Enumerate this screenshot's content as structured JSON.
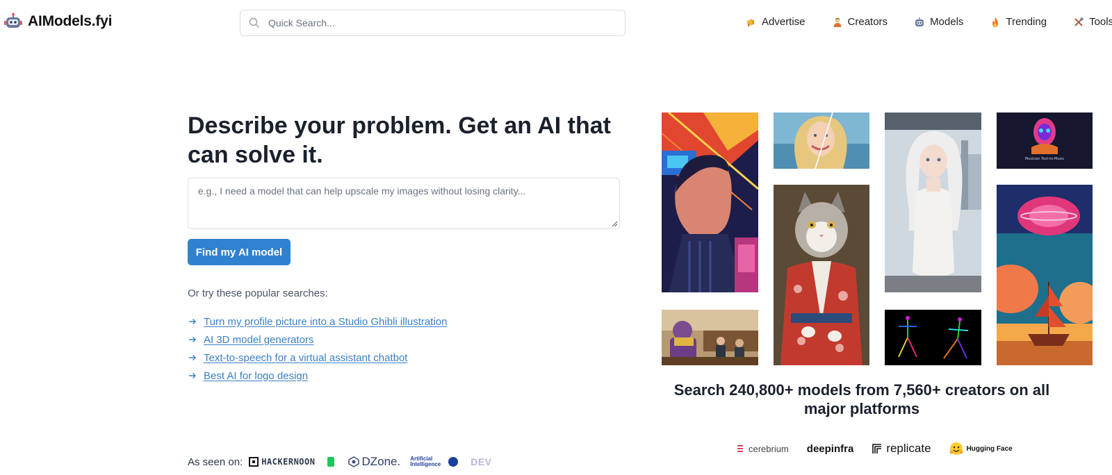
{
  "header": {
    "logo_text": "AIModels.fyi",
    "search_placeholder": "Quick Search...",
    "nav": [
      {
        "label": "Advertise",
        "icon": "megaphone-icon"
      },
      {
        "label": "Creators",
        "icon": "person-icon"
      },
      {
        "label": "Models",
        "icon": "robot-icon"
      },
      {
        "label": "Trending",
        "icon": "fire-icon"
      },
      {
        "label": "Tools",
        "icon": "tools-icon"
      }
    ]
  },
  "hero": {
    "title": "Describe your problem. Get an AI that can solve it.",
    "input_placeholder": "e.g., I need a model that can help upscale my images without losing clarity...",
    "button_label": "Find my AI model",
    "popular_label": "Or try these popular searches:",
    "popular_searches": [
      "Turn my profile picture into a Studio Ghibli illustration",
      "AI 3D model generators",
      "Text-to-speech for a virtual assistant chatbot",
      "Best AI for logo design"
    ]
  },
  "seen_on": {
    "label": "As seen on:",
    "outlets": [
      "HACKERNOON",
      "B",
      "DZone.",
      "Artificial Intelligence",
      "DEV"
    ]
  },
  "gallery": {
    "musician_caption": "Musician Text-to-Music"
  },
  "stats": {
    "text": "Search 240,800+ models from 7,560+ creators on all major platforms"
  },
  "platforms": [
    "cerebrium",
    "deepinfra",
    "replicate",
    "Hugging Face"
  ],
  "colors": {
    "accent": "#3182ce",
    "link": "#3b7fc4",
    "text": "#1a202c"
  }
}
